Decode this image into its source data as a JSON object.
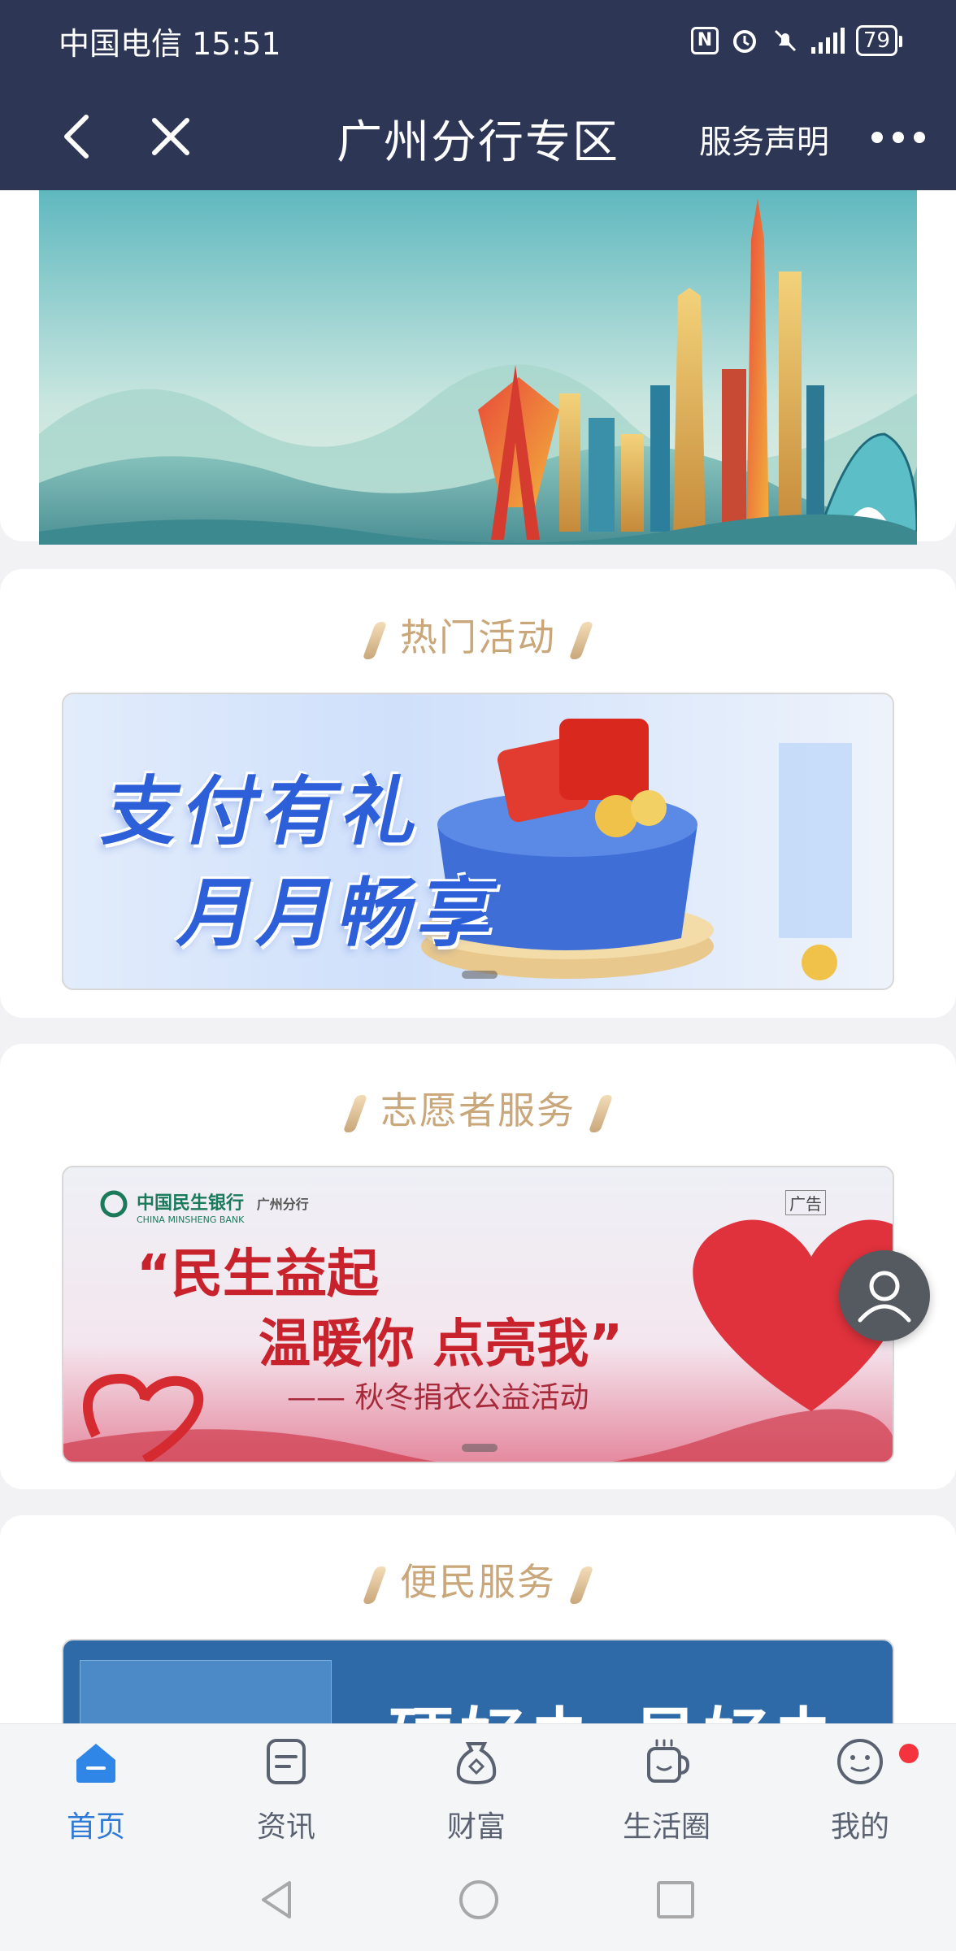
{
  "status_bar": {
    "carrier_time": "中国电信 15:51",
    "battery": "79"
  },
  "nav": {
    "title": "广州分行专区",
    "service_label": "服务声明"
  },
  "sections": {
    "hot": {
      "title": "热门活动",
      "banner_line1": "支付有礼",
      "banner_line2": "月月畅享"
    },
    "volunteer": {
      "title": "志愿者服务",
      "bank_name": "中国民生银行",
      "bank_en": "CHINA MINSHENG BANK",
      "branch": "广州分行",
      "ad_tag": "广告",
      "quote1": "“民生益起",
      "quote2": "温暖你 点亮我”",
      "subtitle": "—— 秋冬捐衣公益活动"
    },
    "convenience": {
      "title": "便民服务",
      "banner_text": "硬好办 易好办"
    }
  },
  "tabs": [
    {
      "label": "首页",
      "icon": "home-icon"
    },
    {
      "label": "资讯",
      "icon": "news-icon"
    },
    {
      "label": "财富",
      "icon": "wealth-icon"
    },
    {
      "label": "生活圈",
      "icon": "life-icon"
    },
    {
      "label": "我的",
      "icon": "profile-icon"
    }
  ],
  "colors": {
    "header_bg": "#2e3656",
    "accent_blue": "#2f7ad6",
    "section_gold": "#c9a77a"
  }
}
